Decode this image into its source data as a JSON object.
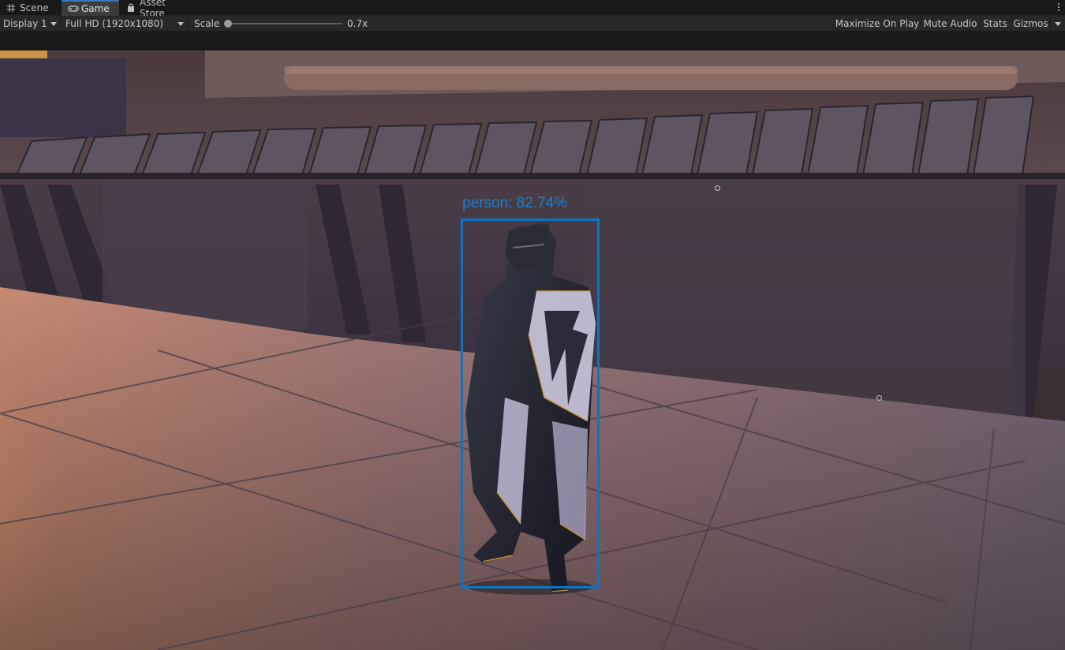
{
  "tabs": [
    {
      "label": "Scene",
      "icon": "grid-icon"
    },
    {
      "label": "Game",
      "icon": "gamepad-icon"
    },
    {
      "label": "Asset Store",
      "icon": "shopping-bag-icon"
    }
  ],
  "active_tab": "Game",
  "toolbar": {
    "display": "Display 1",
    "resolution": "Full HD (1920x1080)",
    "scale_label": "Scale",
    "scale_value": "0.7x",
    "maximize_on_play": "Maximize On Play",
    "mute_audio": "Mute Audio",
    "stats": "Stats",
    "gizmos": "Gizmos"
  },
  "detection": {
    "label": "person: 82.74%",
    "color": "#0b74c6"
  },
  "colors": {
    "accent": "#3a79bb",
    "editor_bg": "#191919",
    "toolbar_bg": "#282828"
  }
}
